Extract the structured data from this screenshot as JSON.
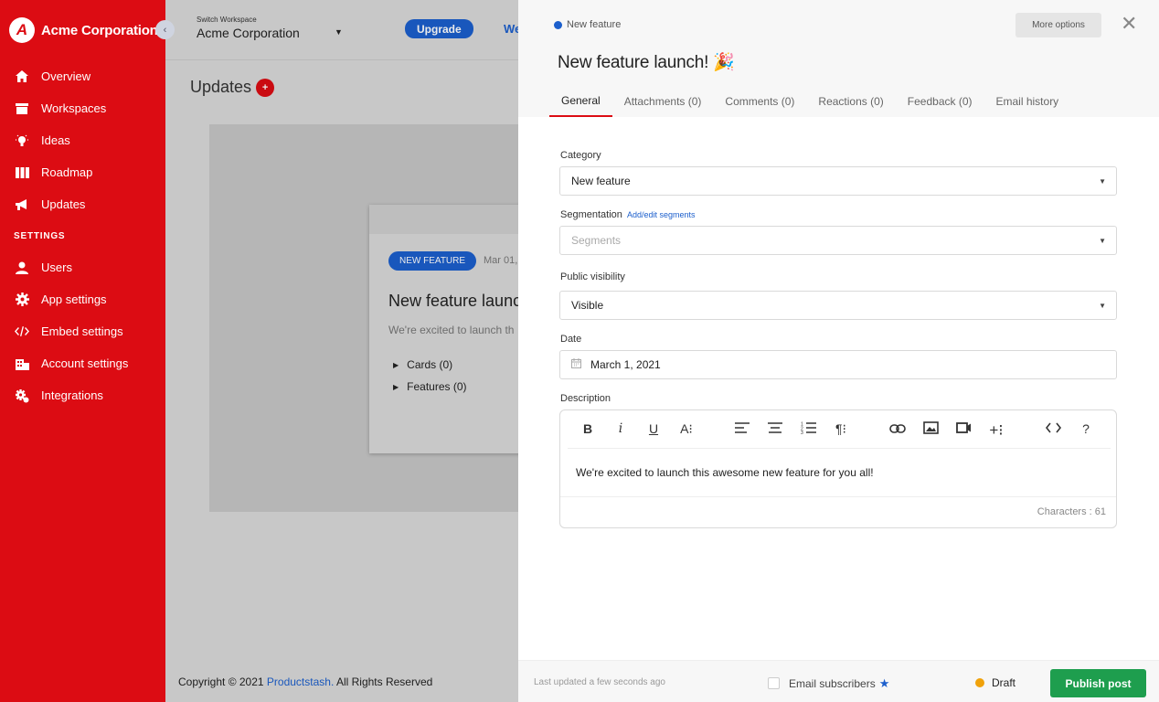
{
  "sidebar": {
    "brand": "Acme Corporation",
    "logo_letter": "A",
    "settings_heading": "SETTINGS",
    "items": [
      {
        "label": "Overview",
        "icon": "home-icon"
      },
      {
        "label": "Workspaces",
        "icon": "inbox-icon"
      },
      {
        "label": "Ideas",
        "icon": "lightbulb-icon"
      },
      {
        "label": "Roadmap",
        "icon": "columns-icon"
      },
      {
        "label": "Updates",
        "icon": "megaphone-icon"
      }
    ],
    "settings_items": [
      {
        "label": "Users",
        "icon": "user-icon"
      },
      {
        "label": "App settings",
        "icon": "gear-icon"
      },
      {
        "label": "Embed settings",
        "icon": "code-icon"
      },
      {
        "label": "Account settings",
        "icon": "building-icon"
      },
      {
        "label": "Integrations",
        "icon": "gear-plug-icon"
      }
    ]
  },
  "topbar": {
    "workspace_label": "Switch Workspace",
    "workspace_name": "Acme Corporation",
    "upgrade_label": "Upgrade",
    "link_partial": "We"
  },
  "main": {
    "title": "Updates",
    "add_label": "+",
    "card": {
      "badge": "NEW FEATURE",
      "date": "Mar 01,",
      "title": "New feature launc",
      "description": "We're excited to launch th",
      "cards_label": "Cards (0)",
      "features_label": "Features (0)"
    },
    "footer_prefix": "Copyright © 2021 ",
    "footer_link": "Productstash.",
    "footer_suffix": " All Rights Reserved"
  },
  "drawer": {
    "breadcrumb": "New feature",
    "more_options": "More options",
    "close_glyph": "✕",
    "title": "New feature launch! 🎉",
    "tabs": [
      "General",
      "Attachments (0)",
      "Comments (0)",
      "Reactions (0)",
      "Feedback (0)",
      "Email history"
    ],
    "fields": {
      "category_label": "Category",
      "category_value": "New feature",
      "segmentation_label": "Segmentation",
      "segmentation_link": "Add/edit segments",
      "segments_placeholder": "Segments",
      "visibility_label": "Public visibility",
      "visibility_value": "Visible",
      "date_label": "Date",
      "date_value": "March 1, 2021",
      "description_label": "Description"
    },
    "editor": {
      "text": "We're excited to launch this awesome new feature for you all!",
      "char_count": "Characters : 61",
      "tools": [
        "bold-icon",
        "italic-icon",
        "underline-icon",
        "font-size-icon",
        "align-left-icon",
        "align-center-icon",
        "ordered-list-icon",
        "paragraph-icon",
        "link-icon",
        "image-icon",
        "video-icon",
        "insert-more-icon",
        "code-view-icon",
        "help-icon"
      ]
    },
    "footer": {
      "last_updated": "Last updated a few seconds ago",
      "email_subscribers": "Email subscribers",
      "status": "Draft",
      "publish": "Publish post"
    }
  },
  "colors": {
    "brand_red": "#dc0c13",
    "accent_blue": "#1c5fcc",
    "publish_green": "#1e9e4e",
    "draft_orange": "#f0a20b"
  }
}
